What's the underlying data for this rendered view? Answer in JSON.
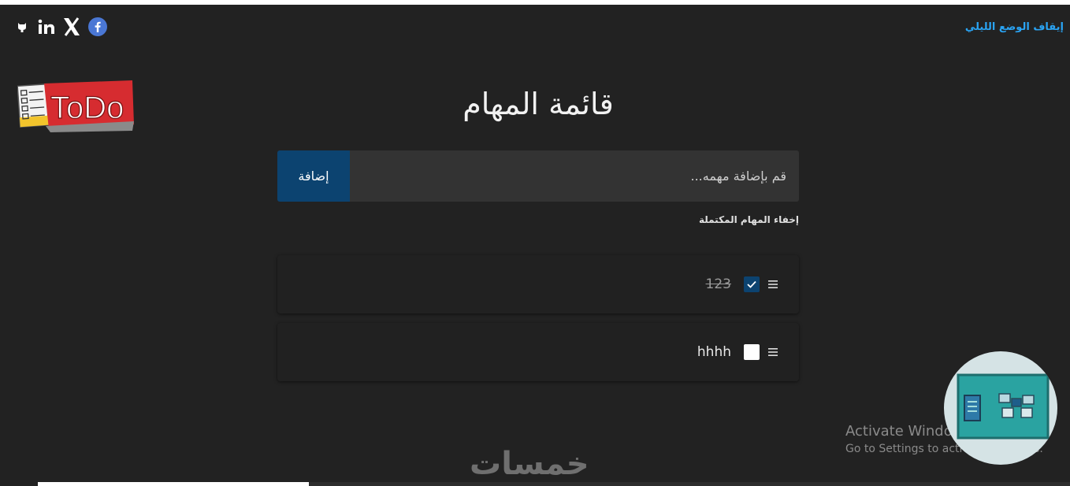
{
  "header": {
    "night_mode_toggle": "إيقاف الوضع الليلي",
    "social_icons": [
      "facebook-icon",
      "x-icon",
      "linkedin-icon",
      "github-icon"
    ]
  },
  "logo": {
    "text": "ToDo"
  },
  "main": {
    "title": "قائمة المهام",
    "add_input_placeholder": "قم بإضافة مهمه...",
    "add_button_label": "إضافة",
    "hide_completed_label": "إخفاء المهام المكتملة"
  },
  "tasks": [
    {
      "text": "123",
      "completed": true
    },
    {
      "text": "hhhh",
      "completed": false
    }
  ],
  "overlay": {
    "activate_title": "Activate Windows",
    "activate_subtitle": "Go to Settings to activate Windows.",
    "watermark_text": "خمسات"
  },
  "colors": {
    "background": "#222222",
    "accent": "#0c4370",
    "link": "#2aa4f4"
  }
}
